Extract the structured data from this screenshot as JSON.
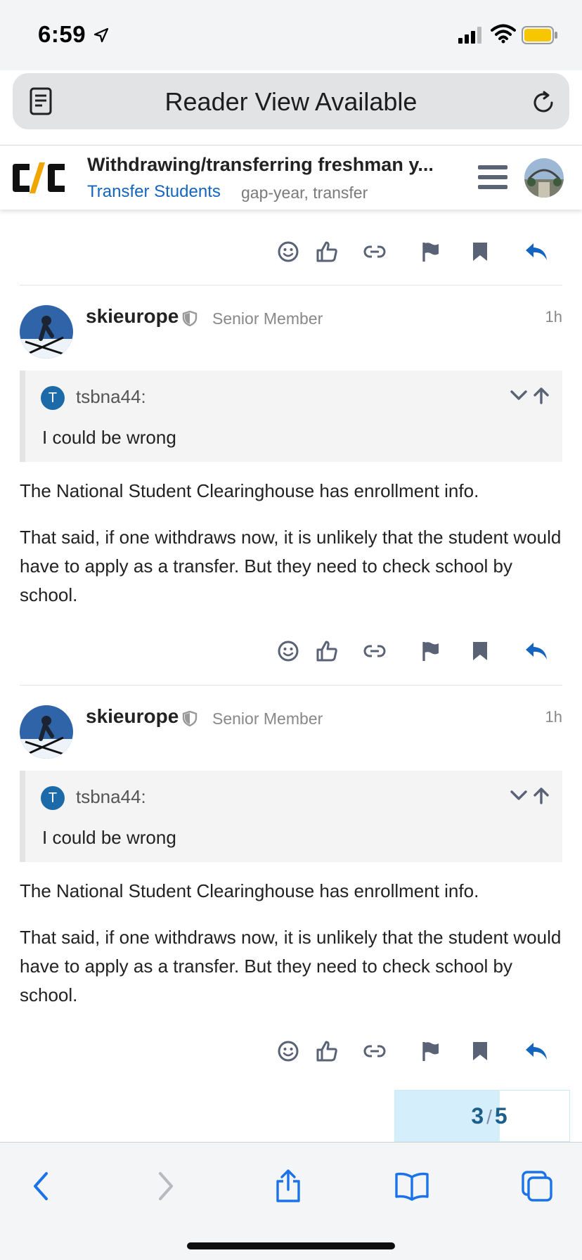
{
  "status": {
    "time": "6:59"
  },
  "address_bar": {
    "text": "Reader View Available"
  },
  "topic": {
    "title": "Withdrawing/transferring freshman y...",
    "category": "Transfer Students",
    "tags": "gap-year, transfer"
  },
  "posts": [
    {
      "username": "skieurope",
      "user_title": "Senior Member",
      "time": "1h",
      "quote": {
        "avatar_letter": "T",
        "author": "tsbna44:",
        "text": "I could be wrong"
      },
      "paragraphs": [
        "The National Student Clearinghouse has enrollment info.",
        "That said, if one withdraws now, it is unlikely that the student would have to apply as a transfer. But they need to check school by school."
      ]
    },
    {
      "username": "skieurope",
      "user_title": "Senior Member",
      "time": "1h",
      "quote": {
        "avatar_letter": "T",
        "author": "tsbna44:",
        "text": "I could be wrong"
      },
      "paragraphs": [
        "The National Student Clearinghouse has enrollment info.",
        "That said, if one withdraws now, it is unlikely that the student would have to apply as a transfer. But they need to check school by school."
      ]
    }
  ],
  "progress": {
    "current": "3",
    "separator": "/",
    "total": "5",
    "fraction": 0.6
  },
  "colors": {
    "accent": "#1565c0",
    "icon_gray": "#5a6275",
    "reply_blue": "#1565c0"
  }
}
